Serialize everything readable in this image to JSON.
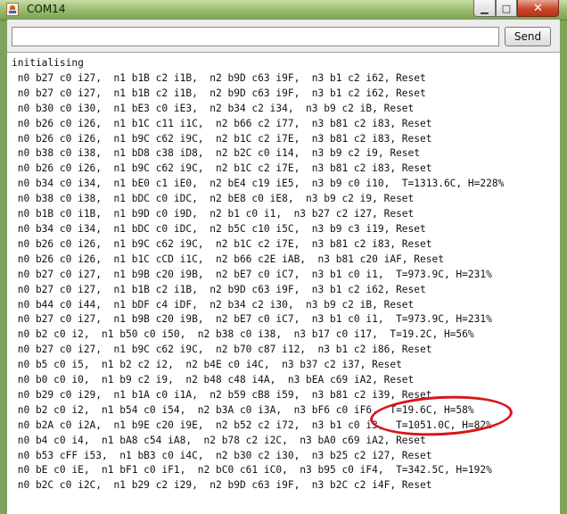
{
  "window": {
    "title": "COM14",
    "minimize_glyph": "▁",
    "maximize_glyph": "□",
    "close_glyph": "✕"
  },
  "toolbar": {
    "input_value": "",
    "send_label": "Send"
  },
  "console": {
    "lines": [
      "initialising",
      " n0 b27 c0 i27,  n1 b1B c2 i1B,  n2 b9D c63 i9F,  n3 b1 c2 i62, Reset",
      " n0 b27 c0 i27,  n1 b1B c2 i1B,  n2 b9D c63 i9F,  n3 b1 c2 i62, Reset",
      " n0 b30 c0 i30,  n1 bE3 c0 iE3,  n2 b34 c2 i34,  n3 b9 c2 iB, Reset",
      " n0 b26 c0 i26,  n1 b1C c11 i1C,  n2 b66 c2 i77,  n3 b81 c2 i83, Reset",
      " n0 b26 c0 i26,  n1 b9C c62 i9C,  n2 b1C c2 i7E,  n3 b81 c2 i83, Reset",
      " n0 b38 c0 i38,  n1 bD8 c38 iD8,  n2 b2C c0 i14,  n3 b9 c2 i9, Reset",
      " n0 b26 c0 i26,  n1 b9C c62 i9C,  n2 b1C c2 i7E,  n3 b81 c2 i83, Reset",
      " n0 b34 c0 i34,  n1 bE0 c1 iE0,  n2 bE4 c19 iE5,  n3 b9 c0 i10,  T=1313.6C, H=228%",
      " n0 b38 c0 i38,  n1 bDC c0 iDC,  n2 bE8 c0 iE8,  n3 b9 c2 i9, Reset",
      " n0 b1B c0 i1B,  n1 b9D c0 i9D,  n2 b1 c0 i1,  n3 b27 c2 i27, Reset",
      " n0 b34 c0 i34,  n1 bDC c0 iDC,  n2 b5C c10 i5C,  n3 b9 c3 i19, Reset",
      " n0 b26 c0 i26,  n1 b9C c62 i9C,  n2 b1C c2 i7E,  n3 b81 c2 i83, Reset",
      " n0 b26 c0 i26,  n1 b1C cCD i1C,  n2 b66 c2E iAB,  n3 b81 c20 iAF, Reset",
      " n0 b27 c0 i27,  n1 b9B c20 i9B,  n2 bE7 c0 iC7,  n3 b1 c0 i1,  T=973.9C, H=231%",
      " n0 b27 c0 i27,  n1 b1B c2 i1B,  n2 b9D c63 i9F,  n3 b1 c2 i62, Reset",
      " n0 b44 c0 i44,  n1 bDF c4 iDF,  n2 b34 c2 i30,  n3 b9 c2 iB, Reset",
      " n0 b27 c0 i27,  n1 b9B c20 i9B,  n2 bE7 c0 iC7,  n3 b1 c0 i1,  T=973.9C, H=231%",
      " n0 b2 c0 i2,  n1 b50 c0 i50,  n2 b38 c0 i38,  n3 b17 c0 i17,  T=19.2C, H=56%",
      " n0 b27 c0 i27,  n1 b9C c62 i9C,  n2 b70 c87 i12,  n3 b1 c2 i86, Reset",
      " n0 b5 c0 i5,  n1 b2 c2 i2,  n2 b4E c0 i4C,  n3 b37 c2 i37, Reset",
      " n0 b0 c0 i0,  n1 b9 c2 i9,  n2 b48 c48 i4A,  n3 bEA c69 iA2, Reset",
      " n0 b29 c0 i29,  n1 b1A c0 i1A,  n2 b59 cB8 i59,  n3 b81 c2 i39, Reset",
      " n0 b2 c0 i2,  n1 b54 c0 i54,  n2 b3A c0 i3A,  n3 bF6 c0 iF6,  T=19.6C, H=58%",
      " n0 b2A c0 i2A,  n1 b9E c20 i9E,  n2 b52 c2 i72,  n3 b1 c0 i3,  T=1051.0C, H=82%",
      " n0 b4 c0 i4,  n1 bA8 c54 iA8,  n2 b78 c2 i2C,  n3 bA0 c69 iA2, Reset",
      " n0 b53 cFF i53,  n1 bB3 c0 i4C,  n2 b30 c2 i30,  n3 b25 c2 i27, Reset",
      " n0 bE c0 iE,  n1 bF1 c0 iF1,  n2 bC0 c61 iC0,  n3 b95 c0 iF4,  T=342.5C, H=192%",
      " n0 b2C c0 i2C,  n1 b29 c2 i29,  n2 b9D c63 i9F,  n3 b2C c2 i4F, Reset"
    ]
  },
  "annotation": {
    "color": "#d9141b"
  }
}
